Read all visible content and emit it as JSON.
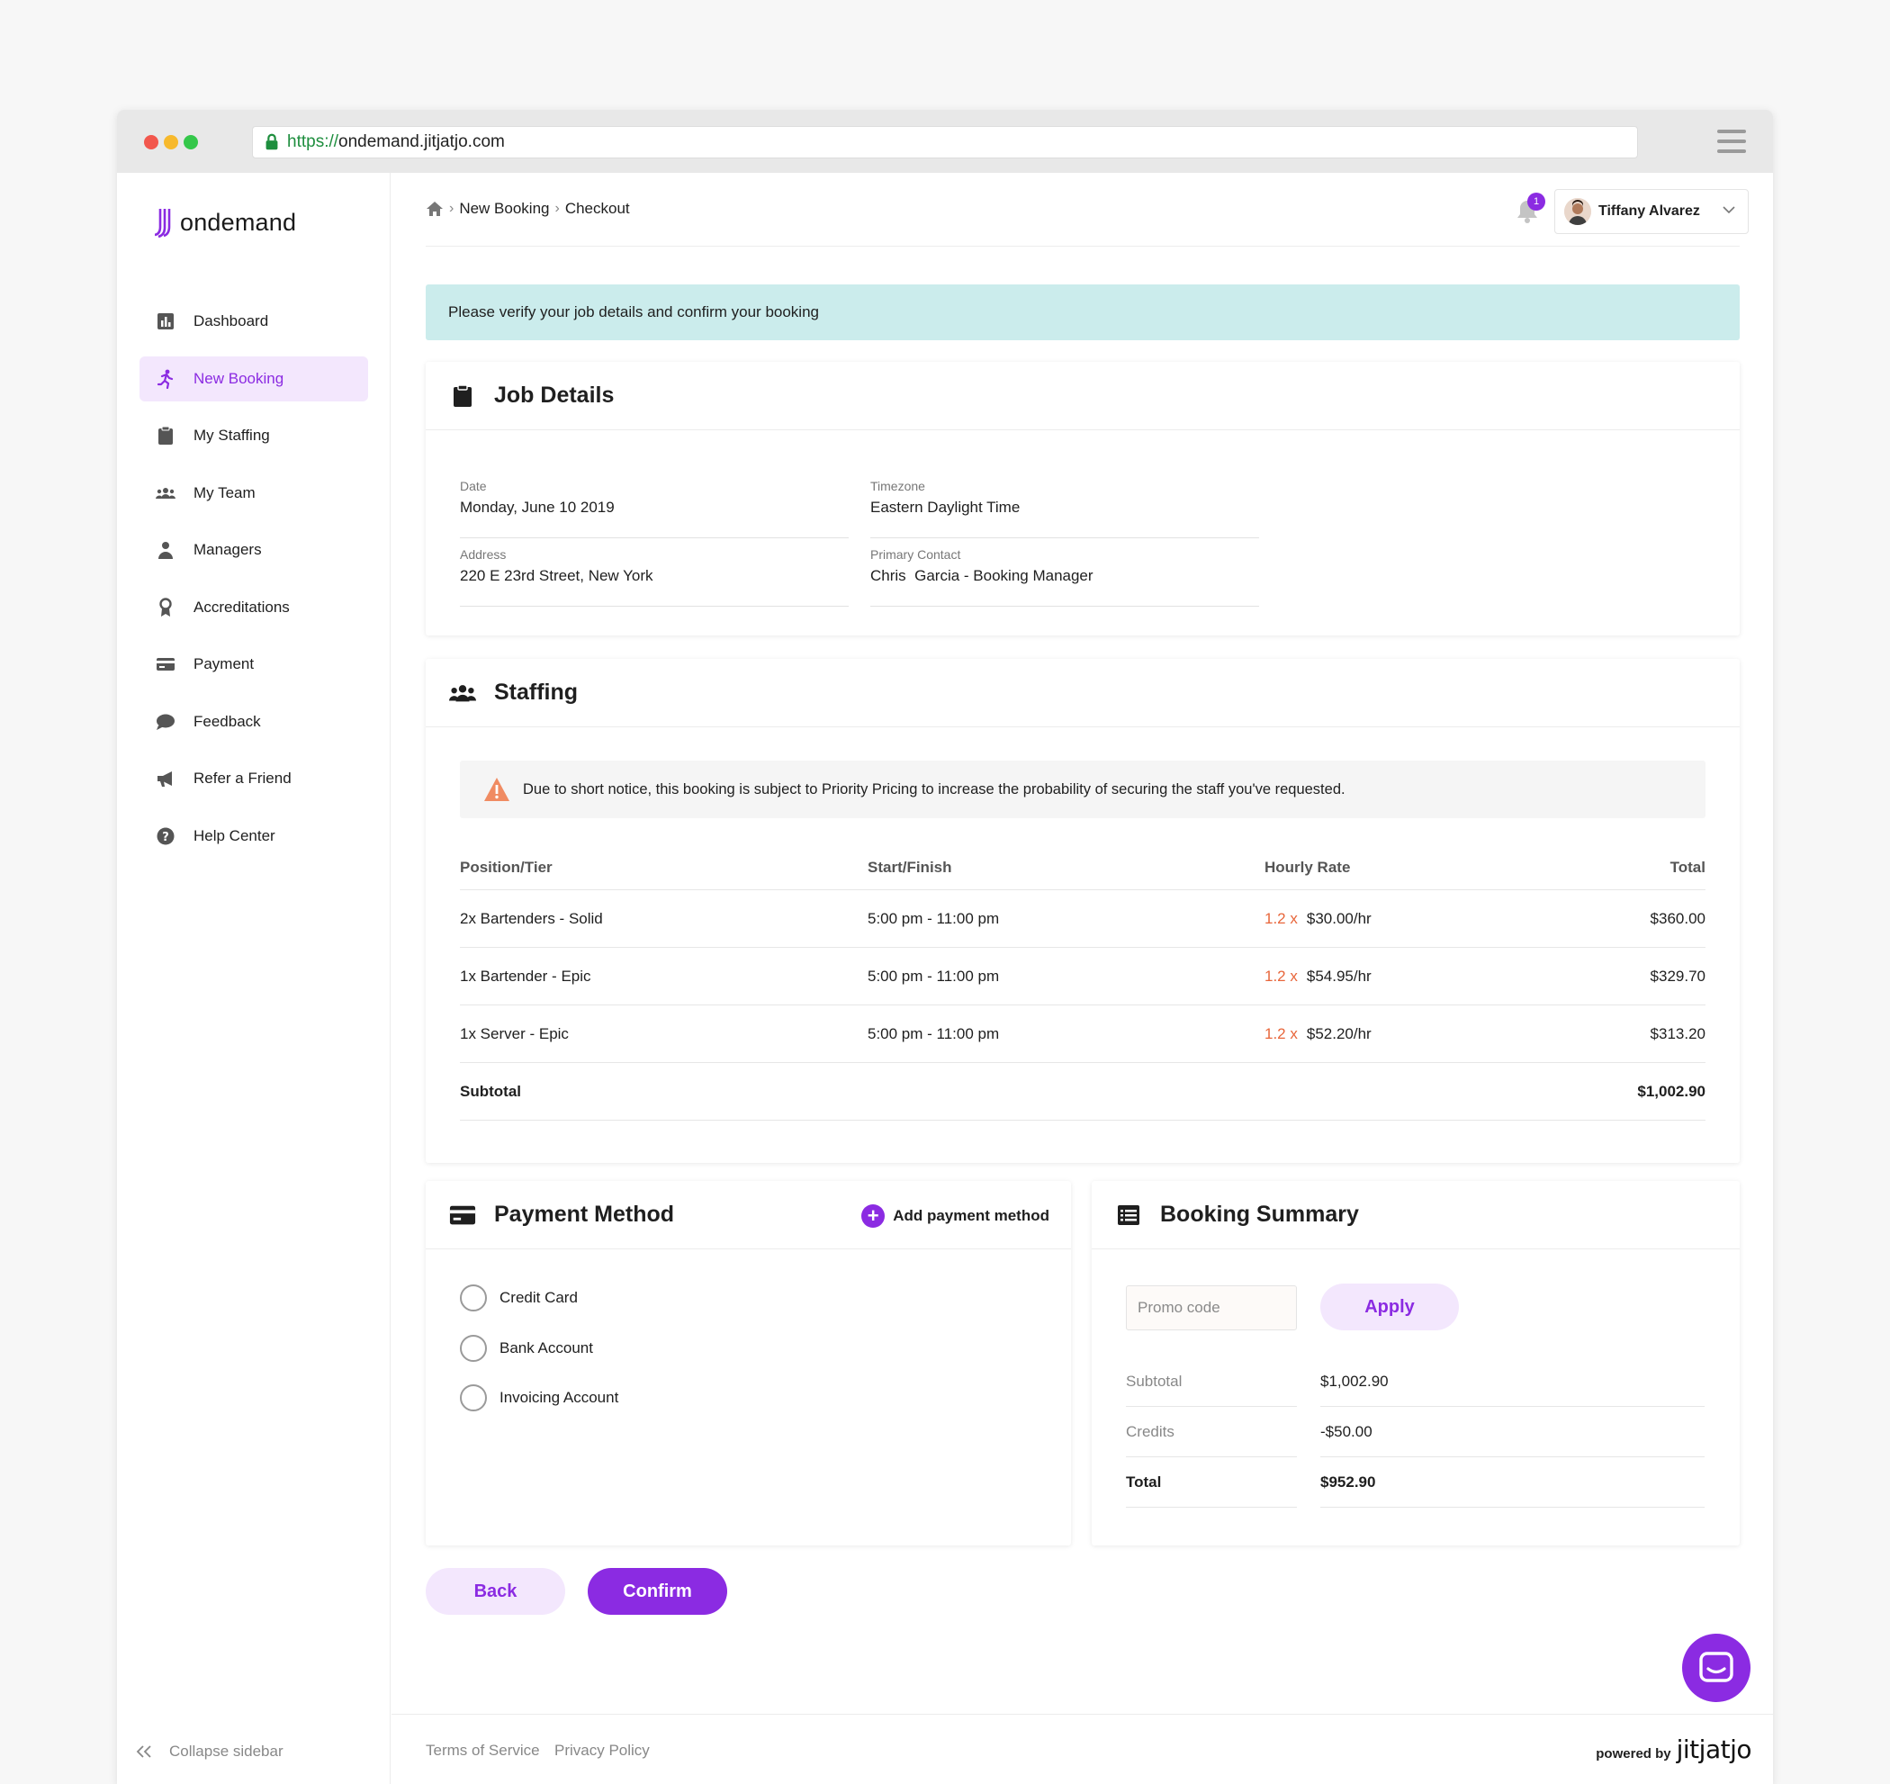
{
  "browser": {
    "url_scheme": "https://",
    "url_host": "ondemand.jitjatjo.com"
  },
  "brand": {
    "logo_text": "ondemand",
    "accent_color": "#8b2be2"
  },
  "sidebar": {
    "items": [
      {
        "label": "Dashboard",
        "icon": "bar-chart-icon"
      },
      {
        "label": "New Booking",
        "icon": "running-person-icon",
        "active": true
      },
      {
        "label": "My Staffing",
        "icon": "clipboard-icon"
      },
      {
        "label": "My Team",
        "icon": "group-icon"
      },
      {
        "label": "Managers",
        "icon": "manager-icon"
      },
      {
        "label": "Accreditations",
        "icon": "award-icon"
      },
      {
        "label": "Payment",
        "icon": "credit-card-icon"
      },
      {
        "label": "Feedback",
        "icon": "speech-bubble-icon"
      },
      {
        "label": "Refer a Friend",
        "icon": "megaphone-icon"
      },
      {
        "label": "Help Center",
        "icon": "question-icon"
      }
    ],
    "collapse_label": "Collapse sidebar"
  },
  "header": {
    "breadcrumb": [
      "New Booking",
      "Checkout"
    ],
    "notification_count": "1",
    "user_name": "Tiffany Alvarez"
  },
  "notice": "Please verify your job details and confirm your booking",
  "job_details": {
    "title": "Job Details",
    "date_label": "Date",
    "date_value": "Monday, June 10 2019",
    "timezone_label": "Timezone",
    "timezone_value": "Eastern Daylight Time",
    "address_label": "Address",
    "address_value": "220 E 23rd Street, New York",
    "contact_label": "Primary Contact",
    "contact_value": "Chris  Garcia - Booking Manager"
  },
  "staffing": {
    "title": "Staffing",
    "warning": "Due to short notice, this booking is subject to Priority Pricing to increase the probability of securing the staff you've requested.",
    "columns": [
      "Position/Tier",
      "Start/Finish",
      "Hourly Rate",
      "Total"
    ],
    "rows": [
      {
        "position": "2x Bartenders - Solid",
        "time": "5:00 pm - 11:00 pm",
        "multiplier": "1.2 x",
        "rate": "$30.00/hr",
        "total": "$360.00"
      },
      {
        "position": "1x Bartender - Epic",
        "time": "5:00 pm - 11:00 pm",
        "multiplier": "1.2 x",
        "rate": "$54.95/hr",
        "total": "$329.70"
      },
      {
        "position": "1x Server - Epic",
        "time": "5:00 pm - 11:00 pm",
        "multiplier": "1.2 x",
        "rate": "$52.20/hr",
        "total": "$313.20"
      }
    ],
    "subtotal_label": "Subtotal",
    "subtotal_value": "$1,002.90"
  },
  "payment": {
    "title": "Payment Method",
    "add_label": "Add payment method",
    "options": [
      "Credit Card",
      "Bank Account",
      "Invoicing Account"
    ]
  },
  "summary": {
    "title": "Booking Summary",
    "promo_placeholder": "Promo code",
    "apply_label": "Apply",
    "subtotal_label": "Subtotal",
    "subtotal_value": "$1,002.90",
    "credits_label": "Credits",
    "credits_value": "-$50.00",
    "total_label": "Total",
    "total_value": "$952.90"
  },
  "actions": {
    "back_label": "Back",
    "confirm_label": "Confirm"
  },
  "footer": {
    "terms": "Terms of Service",
    "privacy": "Privacy Policy",
    "powered_by": "powered by",
    "brand": "jitjatjo"
  }
}
